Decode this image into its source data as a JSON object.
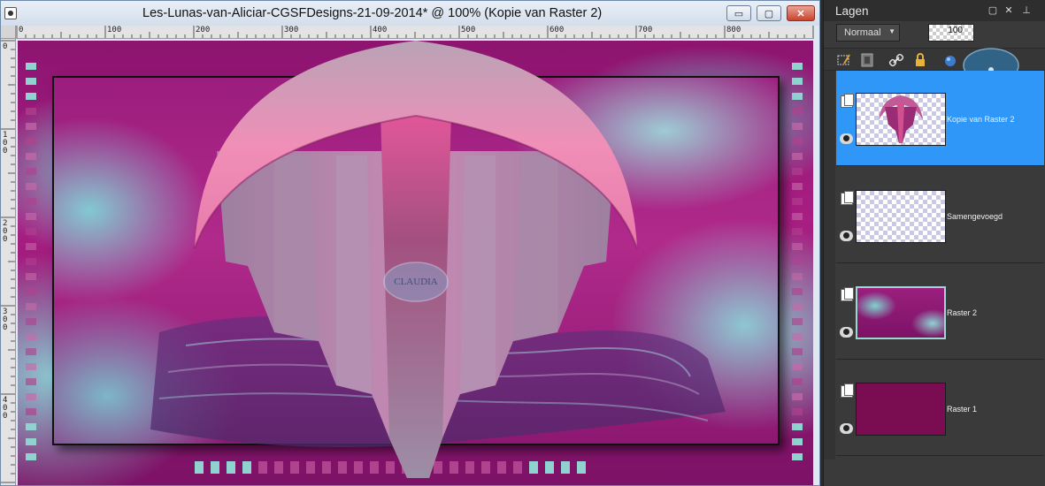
{
  "document": {
    "title": "Les-Lunas-van-Aliciar-CGSFDesigns-21-09-2014* @ 100% (Kopie van Raster 2)",
    "window_controls": {
      "minimize": "▭",
      "maximize": "▢",
      "close": "✕"
    },
    "ruler_top_labels": [
      "0",
      "100",
      "200",
      "300",
      "400",
      "500",
      "600",
      "700",
      "800"
    ],
    "ruler_left_labels": [
      "0",
      "100",
      "200",
      "300",
      "400"
    ],
    "canvas": {
      "watermark_text": "CLAUDIA",
      "colors": {
        "magenta": "#a01a80",
        "teal": "#8fd2d0",
        "pink_light": "#f080b0",
        "mauve": "#a987a8"
      }
    }
  },
  "layers_panel": {
    "title": "Lagen",
    "header_buttons": {
      "maximize": "▢",
      "close": "✕",
      "pin": "⊥"
    },
    "blend_mode": "Normaal",
    "opacity": "100",
    "layers": [
      {
        "name": "Kopie van Raster 2",
        "selected": true,
        "thumb": "checker-art"
      },
      {
        "name": "Samengevoegd",
        "selected": false,
        "thumb": "checker"
      },
      {
        "name": "Raster 2",
        "selected": false,
        "thumb": "teal-art"
      },
      {
        "name": "Raster 1",
        "selected": false,
        "thumb": "solid",
        "color": "#7a0d52"
      }
    ],
    "accent_color": "#2e97f8"
  }
}
